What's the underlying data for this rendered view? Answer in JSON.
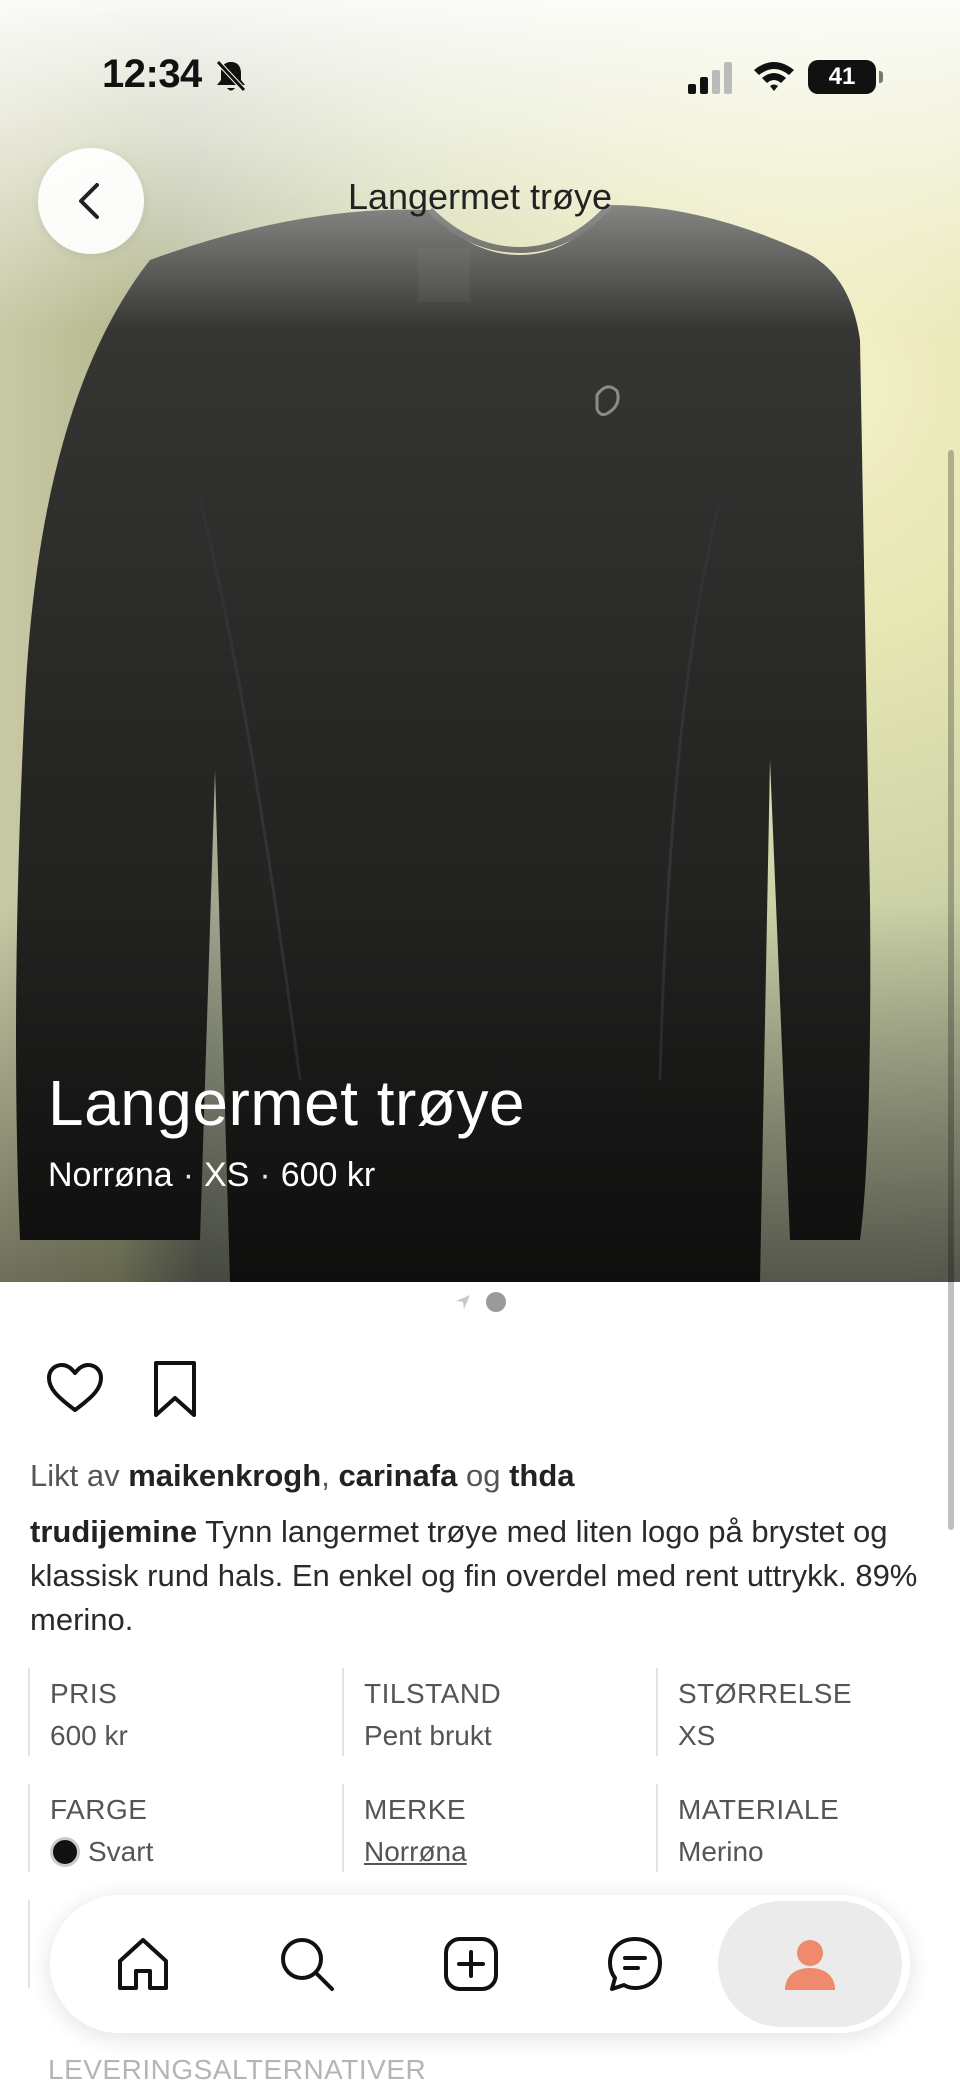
{
  "status_bar": {
    "time": "12:34",
    "battery": "41"
  },
  "header": {
    "title": "Langermet trøye"
  },
  "hero": {
    "title": "Langermet trøye",
    "brand": "Norrøna",
    "size": "XS",
    "price": "600 kr",
    "separator": "·"
  },
  "actions": {
    "like_icon": "heart-icon",
    "save_icon": "bookmark-icon"
  },
  "likes": {
    "prefix": "Likt av",
    "users": [
      "maikenkrogh",
      "carinafa",
      "thda"
    ],
    "comma": ",",
    "and": "og"
  },
  "description": {
    "author": "trudijemine",
    "text": "Tynn langermet trøye med liten logo på brystet og klassisk rund hals. En enkel og fin overdel med rent uttrykk. 89% merino."
  },
  "specs": [
    {
      "label": "PRIS",
      "value": "600 kr"
    },
    {
      "label": "TILSTAND",
      "value": "Pent brukt"
    },
    {
      "label": "STØRRELSE",
      "value": "XS"
    },
    {
      "label": "FARGE",
      "value": "Svart",
      "color": "#111111"
    },
    {
      "label": "MERKE",
      "value": "Norrøna"
    },
    {
      "label": "MATERIALE",
      "value": "Merino"
    }
  ],
  "delivery_heading": "LEVERINGSALTERNATIVER",
  "tabbar": {
    "items": [
      {
        "icon": "home-icon"
      },
      {
        "icon": "search-icon"
      },
      {
        "icon": "add-icon"
      },
      {
        "icon": "messages-icon"
      },
      {
        "icon": "profile-icon",
        "active": true,
        "color": "#f08a6c"
      }
    ]
  }
}
